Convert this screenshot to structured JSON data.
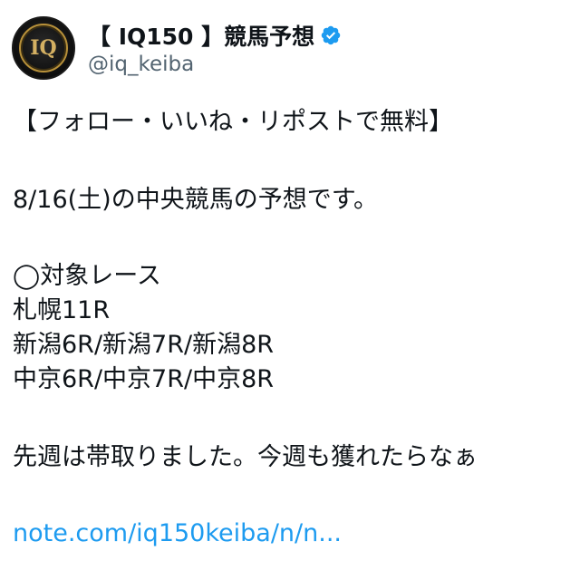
{
  "account": {
    "display_name": "【 IQ150 】競馬予想",
    "handle": "@iq_keiba",
    "avatar_text": "IQ",
    "verified": true,
    "colors": {
      "avatar_gold": "#d4b062",
      "verified_blue": "#1d9bf0"
    }
  },
  "tweet": {
    "lines": [
      "【フォロー・いいね・リポストで無料】",
      "8/16(土)の中央競馬の予想です。",
      "◯対象レース",
      "札幌11R",
      "新潟6R/新潟7R/新潟8R",
      "中京6R/中京7R/中京8R",
      "先週は帯取りました。今週も獲れたらなぁ"
    ],
    "link_text": "note.com/iq150keiba/n/n...",
    "link_color": "#1d9bf0"
  }
}
